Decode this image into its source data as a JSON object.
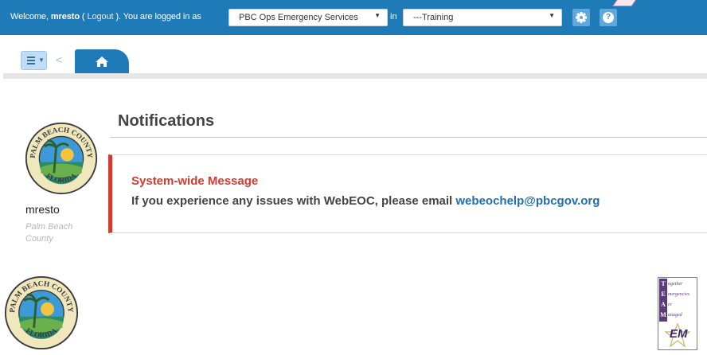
{
  "header": {
    "welcome_prefix": "Welcome, ",
    "username": "mresto",
    "logout_open": " ( ",
    "logout_label": "Logout",
    "logout_close": " ). You are logged in as",
    "position_value": "PBC Ops Emergency Services",
    "in_label": "in",
    "incident_value": "---Training",
    "settings_icon": "gear-icon",
    "help_icon": "question-circle-icon",
    "help_glyph": "?"
  },
  "toolbar": {
    "menu_icon": "hamburger-icon",
    "back_icon": "chevron-left-icon",
    "back_glyph": "<",
    "home_icon": "home-icon"
  },
  "profile": {
    "username": "mresto",
    "org_line1": "Palm Beach",
    "org_line2": "County",
    "seal_top_text": "PALM BEACH COUNTY",
    "seal_bottom_text": "FLORIDA"
  },
  "notifications": {
    "title": "Notifications",
    "message_heading": "System-wide Message",
    "message_text": "If you experience any issues with WebEOC, please email ",
    "message_email": "webeochelp@pbcgov.org"
  },
  "footer": {
    "team_letters": [
      "T",
      "E",
      "A",
      "M"
    ],
    "team_words": [
      "ogether",
      "mergencies",
      "re",
      "anaged"
    ],
    "team_em": "EM"
  },
  "colors": {
    "header_blue": "#1f7ab8",
    "alert_red": "#d33b2f",
    "link_blue": "#1f6fb2",
    "team_purple": "#5b3b7a"
  }
}
